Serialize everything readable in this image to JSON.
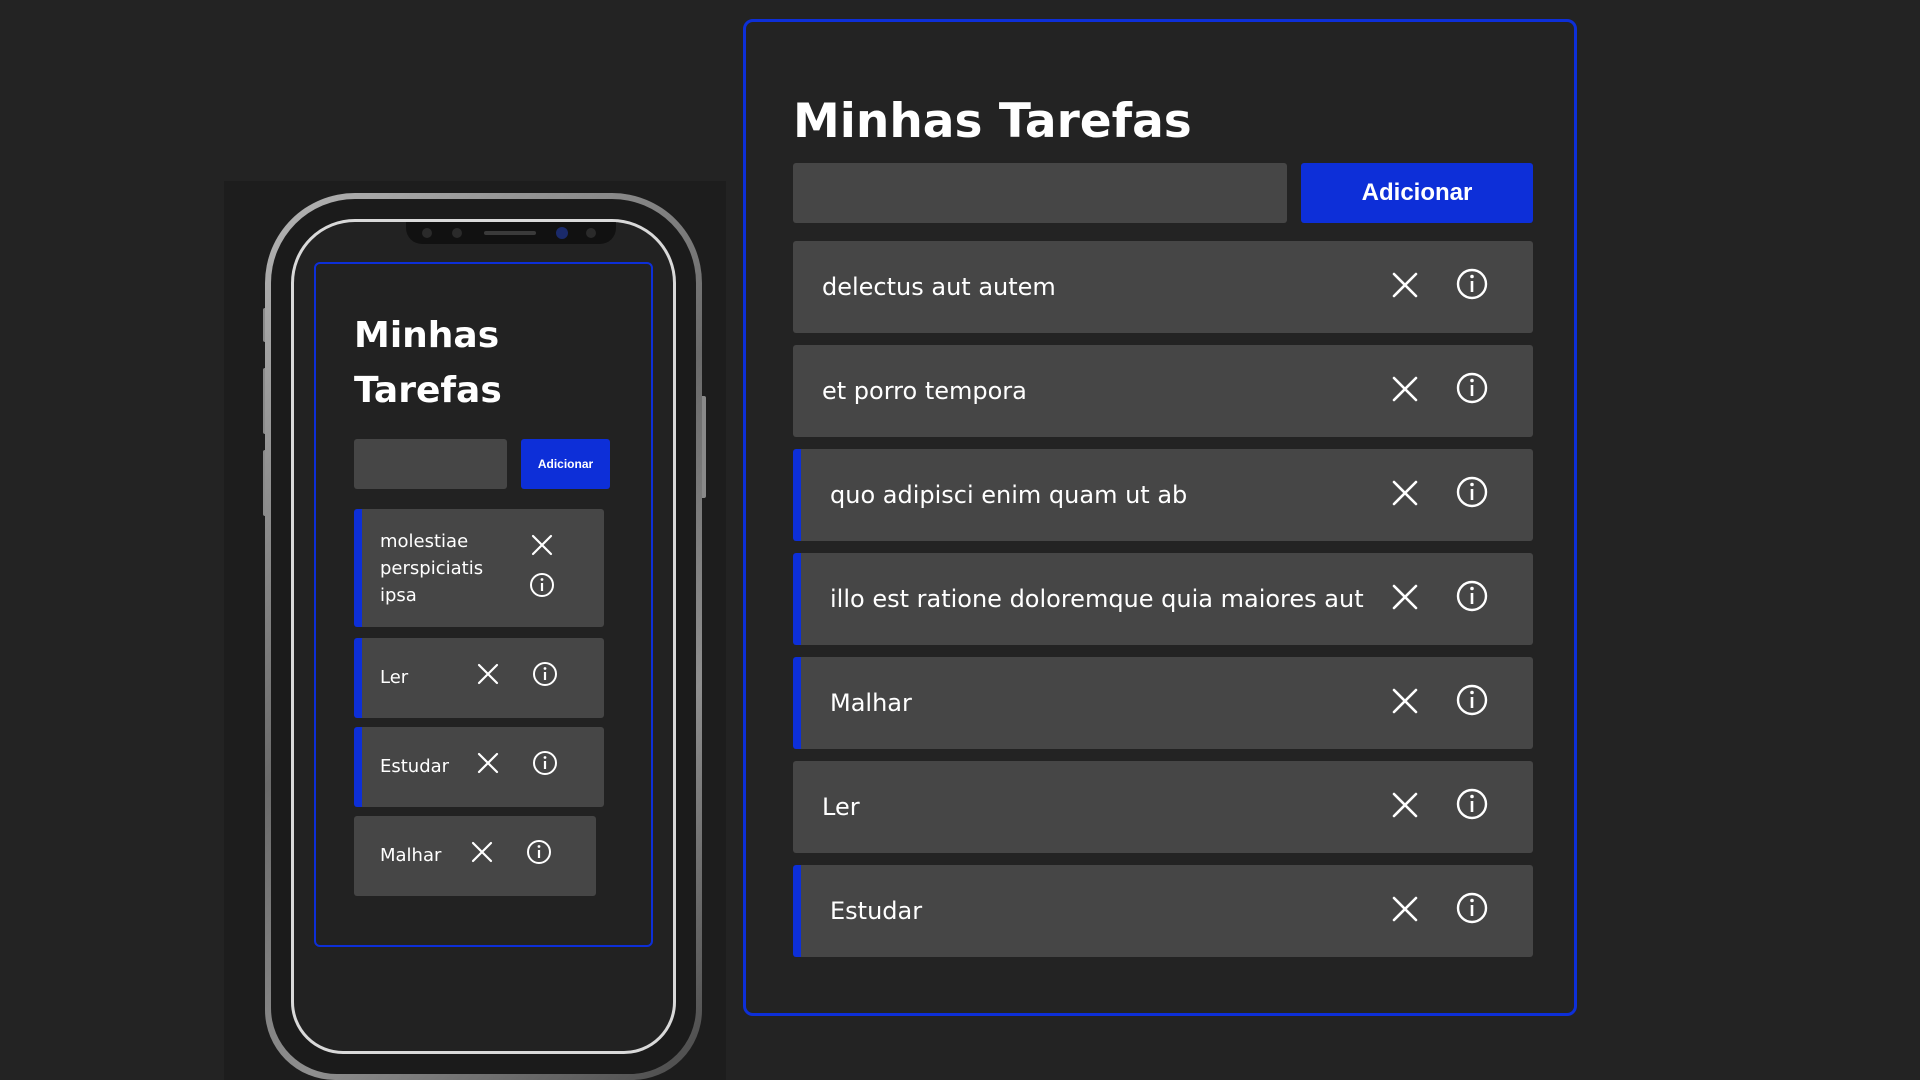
{
  "mobile": {
    "title": "Minhas Tarefas",
    "input_placeholder": "",
    "add_button": "Adicionar",
    "tasks": [
      {
        "label": "molestiae perspiciatis ipsa",
        "accent": true
      },
      {
        "label": "Ler",
        "accent": true
      },
      {
        "label": "Estudar",
        "accent": true
      },
      {
        "label": "Malhar",
        "accent": false
      }
    ]
  },
  "desktop": {
    "title": "Minhas Tarefas",
    "input_placeholder": "",
    "add_button": "Adicionar",
    "tasks": [
      {
        "label": "delectus aut autem",
        "accent": false
      },
      {
        "label": "et porro tempora",
        "accent": false
      },
      {
        "label": "quo adipisci enim quam ut ab",
        "accent": true
      },
      {
        "label": "illo est ratione doloremque quia maiores aut",
        "accent": true
      },
      {
        "label": "Malhar",
        "accent": true
      },
      {
        "label": "Ler",
        "accent": false
      },
      {
        "label": "Estudar",
        "accent": true
      }
    ]
  },
  "icons": {
    "delete": "close-icon",
    "details": "info-icon"
  },
  "colors": {
    "background": "#232323",
    "accent": "#0d2fd8",
    "item_background": "#464646",
    "text": "#ffffff"
  }
}
